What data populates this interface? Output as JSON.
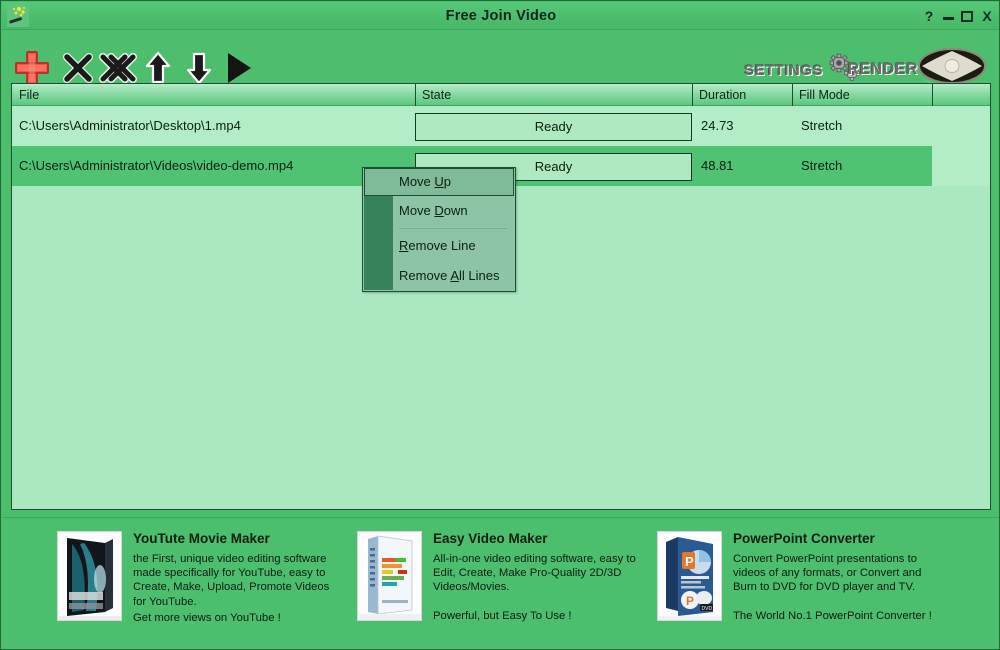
{
  "window": {
    "title": "Free Join Video",
    "app_icon": "magic-wand-icon",
    "controls": {
      "help": "?",
      "minimize": "minimize",
      "maximize": "maximize",
      "close": "X"
    }
  },
  "toolbar": {
    "buttons": [
      {
        "name": "add-file-button",
        "icon": "plus-icon",
        "label": "Add"
      },
      {
        "name": "remove-line-button",
        "icon": "close-x-icon",
        "label": "Remove Line"
      },
      {
        "name": "remove-all-lines-button",
        "icon": "double-x-icon",
        "label": "Remove All Lines"
      },
      {
        "name": "move-up-button",
        "icon": "arrow-up-icon",
        "label": "Move Up"
      },
      {
        "name": "move-down-button",
        "icon": "arrow-down-icon",
        "label": "Move Down"
      },
      {
        "name": "play-button",
        "icon": "play-triangle-icon",
        "label": "Play"
      }
    ],
    "settings_label": "Settings",
    "render_label": "Render"
  },
  "filelist": {
    "columns": [
      "File",
      "State",
      "Duration",
      "Fill Mode",
      ""
    ],
    "rows": [
      {
        "file": "C:\\Users\\Administrator\\Desktop\\1.mp4",
        "state": "Ready",
        "duration": "24.73",
        "fill_mode": "Stretch",
        "selected": false
      },
      {
        "file": "C:\\Users\\Administrator\\Videos\\video-demo.mp4",
        "state": "Ready",
        "duration": "48.81",
        "fill_mode": "Stretch",
        "selected": true
      }
    ]
  },
  "context_menu": {
    "items": [
      {
        "label": "Move Up",
        "accel_index": 5,
        "highlighted": true,
        "separator_after": false
      },
      {
        "label": "Move Down",
        "accel_index": 5,
        "highlighted": false,
        "separator_after": true
      },
      {
        "label": "Remove Line",
        "accel_index": 0,
        "highlighted": false,
        "separator_after": false
      },
      {
        "label": "Remove All Lines",
        "accel_index": 7,
        "highlighted": false,
        "separator_after": false
      }
    ]
  },
  "ads": [
    {
      "thumb": "youtube-movie-maker-box-icon",
      "title": "YouTute Movie Maker",
      "desc": "the First, unique video editing software\nmade specifically for YouTube, easy to\nCreate, Make, Upload, Promote Videos\nfor YouTube.",
      "tagline": "Get more views on YouTube !"
    },
    {
      "thumb": "easy-video-maker-box-icon",
      "title": "Easy Video Maker",
      "desc": "All-in-one video editing software, easy to\nEdit, Create, Make Pro-Quality 2D/3D\nVideos/Movies.",
      "tagline": "Powerful, but Easy To Use !"
    },
    {
      "thumb": "powerpoint-converter-box-icon",
      "title": "PowerPoint Converter",
      "desc": "Convert PowerPoint presentations to\nvideos of any formats, or Convert and\nBurn to DVD for DVD player and TV.",
      "tagline": "The World No.1 PowerPoint Converter !"
    }
  ],
  "colors": {
    "window_bg": "#4bbd6b",
    "titlebar": "#4dbe6e",
    "list_bg": "#a9e8c0",
    "row_odd": "#b3edc7",
    "row_selected": "#4fc273",
    "border": "#1d4f33",
    "accent_red": "#f04b3a",
    "menu_bg": "#8ec4a6",
    "menu_gutter": "#36835b"
  }
}
